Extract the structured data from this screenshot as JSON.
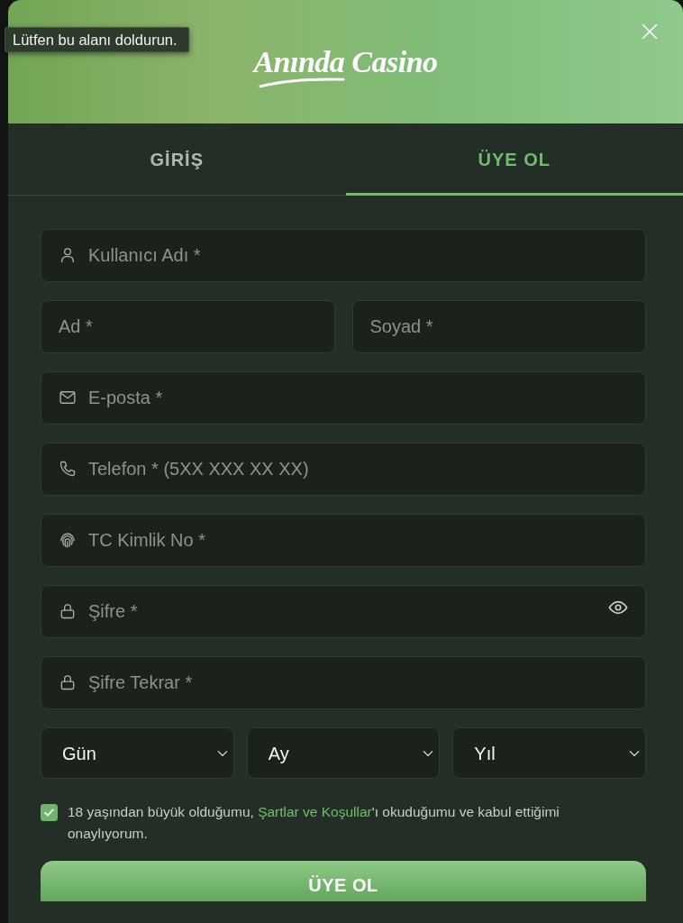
{
  "tooltip": {
    "text": "Lütfen bu alanı doldurun."
  },
  "header": {
    "logo": "Anında Casino"
  },
  "tabs": [
    {
      "label": "GİRİŞ",
      "selected": false
    },
    {
      "label": "ÜYE OL",
      "selected": true
    }
  ],
  "form": {
    "rows": [
      [
        {
          "kind": "username",
          "placeholder": "Kullanıcı Adı *"
        }
      ],
      [
        {
          "kind": "name",
          "placeholder": "Ad *"
        },
        {
          "kind": "name",
          "placeholder": "Soyad *"
        }
      ],
      [
        {
          "kind": "email",
          "placeholder": "E-posta *"
        }
      ],
      [
        {
          "kind": "phone",
          "placeholder": "Telefon * (5XX XXX XX XX)"
        }
      ],
      [
        {
          "kind": "national-id",
          "placeholder": "TC Kimlik No *"
        }
      ],
      [
        {
          "kind": "password",
          "placeholder": "Şifre *",
          "reveal_toggle": true
        }
      ],
      [
        {
          "kind": "password",
          "placeholder": "Şifre Tekrar *",
          "reveal_toggle": false
        }
      ]
    ],
    "birth_date": [
      {
        "value": "Gün"
      },
      {
        "value": "Ay"
      },
      {
        "value": "Yıl"
      }
    ],
    "consent": {
      "checked": true,
      "text_before": "18 yaşından büyük olduğumu, ",
      "link": "Şartlar ve Koşullar",
      "text_after": "'ı okuduğumu ve kabul ettiğimi onaylıyorum."
    },
    "submit": {
      "label": "ÜYE OL"
    }
  }
}
